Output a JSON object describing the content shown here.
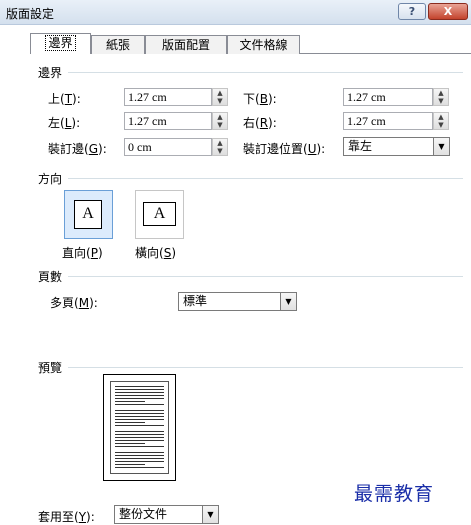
{
  "window": {
    "title": "版面設定",
    "help": "?",
    "close": "X"
  },
  "tabs": [
    {
      "label": "邊界",
      "active": true
    },
    {
      "label": "紙張",
      "active": false
    },
    {
      "label": "版面配置",
      "active": false
    },
    {
      "label": "文件格線",
      "active": false
    }
  ],
  "margins": {
    "section": "邊界",
    "top": {
      "label": "上",
      "key": "T",
      "value": "1.27 cm"
    },
    "bottom": {
      "label": "下",
      "key": "B",
      "value": "1.27 cm"
    },
    "left": {
      "label": "左",
      "key": "L",
      "value": "1.27 cm"
    },
    "right": {
      "label": "右",
      "key": "R",
      "value": "1.27 cm"
    },
    "gutter": {
      "label": "裝訂邊",
      "key": "G",
      "value": "0 cm"
    },
    "gutter_position": {
      "label": "裝訂邊位置",
      "key": "U",
      "value": "靠左"
    }
  },
  "orientation": {
    "section": "方向",
    "portrait": {
      "label": "直向",
      "key": "P",
      "glyph": "A",
      "selected": true
    },
    "landscape": {
      "label": "橫向",
      "key": "S",
      "glyph": "A",
      "selected": false
    }
  },
  "pages": {
    "section": "頁數",
    "multiple": {
      "label": "多頁",
      "key": "M",
      "value": "標準"
    }
  },
  "preview": {
    "section": "預覽"
  },
  "apply_to": {
    "label": "套用至",
    "key": "Y",
    "value": "整份文件"
  },
  "watermark": "最需教育",
  "colors": {
    "accent": "#6a9fd7",
    "watermark": "#1a2ea8",
    "close_button": "#c3432c"
  }
}
